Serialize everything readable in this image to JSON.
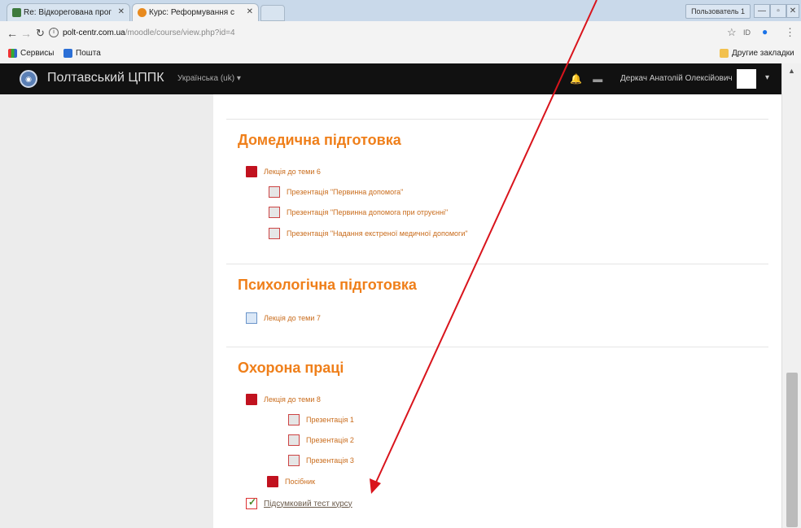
{
  "browser": {
    "tabs": [
      {
        "label": "Re: Відкорегована прог"
      },
      {
        "label": "Курс: Реформування с"
      }
    ],
    "window_user": "Пользователь 1",
    "url_host": "polt-centr.com.ua",
    "url_path": "/moodle/course/view.php?id=4",
    "bookmarks": [
      {
        "label": "Сервисы"
      },
      {
        "label": "Пошта"
      }
    ],
    "other_bookmarks": "Другие закладки"
  },
  "navbar": {
    "site_name": "Полтавський ЦППК",
    "language": "Українська (uk) ▾",
    "user_name": "Деркач Анатолій Олексійович"
  },
  "sections": [
    {
      "title": "Домедична підготовка",
      "items": [
        {
          "label": "Лекція до теми 6",
          "icon": "pdf-icon"
        },
        {
          "label": "Презентація \"Первинна допомога\"",
          "icon": "ppt-icon"
        },
        {
          "label": "Презентація \"Первинна допомога при отруєнні\"",
          "icon": "ppt-icon"
        },
        {
          "label": "Презентація \"Надання екстреної медичної допомоги\"",
          "icon": "ppt-icon"
        }
      ]
    },
    {
      "title": "Психологічна підготовка",
      "items": [
        {
          "label": "Лекція до теми 7",
          "icon": "doc-icon"
        }
      ]
    },
    {
      "title": "Охорона праці",
      "items": [
        {
          "label": "Лекція до теми 8",
          "icon": "pdf-icon"
        },
        {
          "label": "Презентація 1",
          "icon": "ppt-icon"
        },
        {
          "label": "Презентація 2",
          "icon": "ppt-icon"
        },
        {
          "label": "Презентація 3",
          "icon": "ppt-icon"
        },
        {
          "label": "Посібник",
          "icon": "pdf-icon"
        }
      ]
    }
  ],
  "final_quiz": {
    "label": "Підсумковий тест курсу",
    "icon": "quiz-icon"
  },
  "colors": {
    "accent": "#ef7f1a",
    "annotation_arrow": "#d9141c",
    "navbar": "#111111"
  }
}
